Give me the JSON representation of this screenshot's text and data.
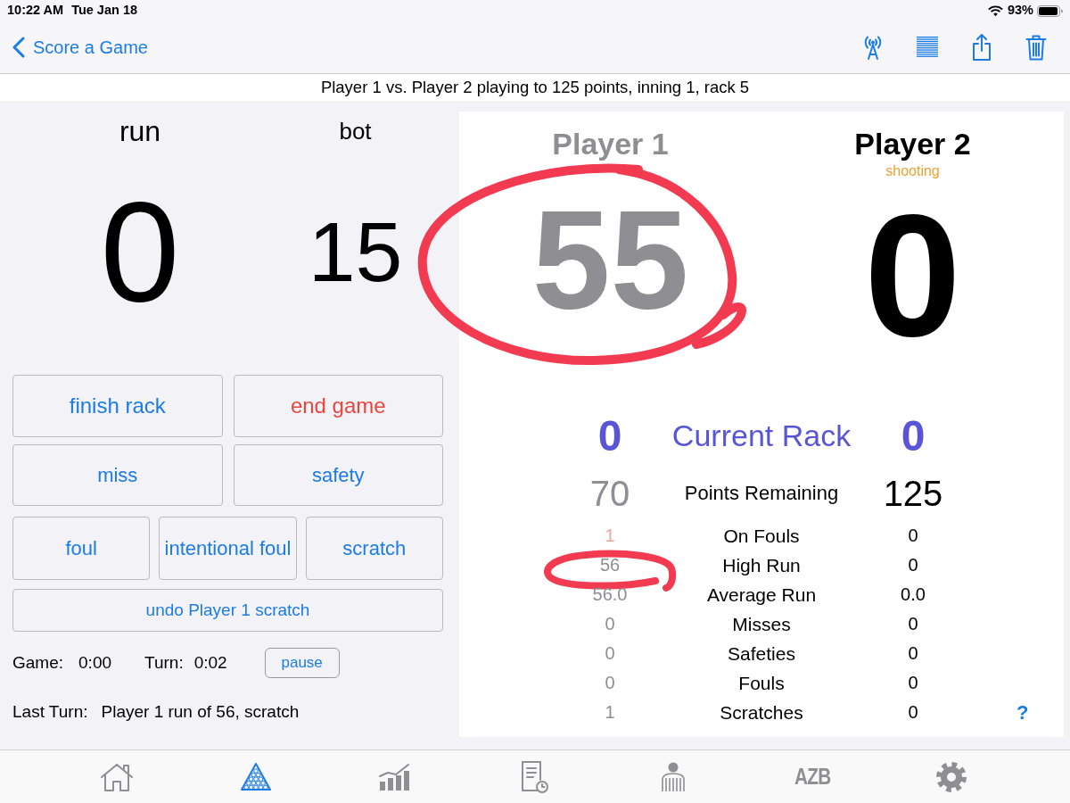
{
  "status_bar": {
    "time": "10:22 AM",
    "date": "Tue Jan 18",
    "battery": "93%"
  },
  "nav_bar": {
    "back": "Score a Game",
    "actions": [
      {
        "kind": "antenna"
      },
      {
        "kind": "list"
      },
      {
        "kind": "share"
      },
      {
        "kind": "trash"
      }
    ]
  },
  "subtitle": "Player 1 vs. Player 2 playing to 125 points, inning 1, rack 5",
  "turn": {
    "columns": [
      {
        "label": "run",
        "value": "0"
      },
      {
        "label": "bot",
        "value": "15"
      }
    ]
  },
  "button_rows": [
    {
      "buttons": [
        {
          "label": "finish rack",
          "kind": "normal"
        },
        {
          "label": "end game",
          "kind": "destructive"
        }
      ]
    },
    {
      "buttons": [
        {
          "label": "miss",
          "kind": "normal"
        },
        {
          "label": "safety",
          "kind": "normal"
        }
      ]
    },
    {
      "buttons": [
        {
          "label": "foul",
          "kind": "normal"
        },
        {
          "label": "intentional foul",
          "kind": "normal"
        },
        {
          "label": "scratch",
          "kind": "normal"
        }
      ]
    },
    {
      "buttons": [
        {
          "label": "undo Player 1 scratch",
          "kind": "normal"
        }
      ]
    }
  ],
  "timers": {
    "game_label": "Game:",
    "game": "0:00",
    "turn_label": "Turn:",
    "turn": "0:02",
    "pause": "pause"
  },
  "last_turn": {
    "label": "Last Turn:",
    "text": "Player 1 run of 56, scratch"
  },
  "scoreboard": {
    "players": [
      {
        "name": "Player 1",
        "shooting": false,
        "score": "55",
        "circled": true
      },
      {
        "name": "Player 2",
        "shooting": true,
        "status": "shooting",
        "score": "0",
        "circled": false
      }
    ],
    "current_rack": {
      "label": "Current Rack",
      "values": [
        "0",
        "0"
      ]
    },
    "points_remaining": {
      "label": "Points Remaining",
      "values": [
        "70",
        "125"
      ]
    },
    "stats": [
      {
        "label": "On Fouls",
        "cells": [
          {
            "value": "1",
            "alert": true,
            "circled": false
          },
          {
            "value": "0",
            "alert": false,
            "circled": false
          }
        ]
      },
      {
        "label": "High Run",
        "cells": [
          {
            "value": "56",
            "alert": false,
            "circled": true
          },
          {
            "value": "0",
            "alert": false,
            "circled": false
          }
        ]
      },
      {
        "label": "Average Run",
        "cells": [
          {
            "value": "56.0",
            "alert": false,
            "circled": false
          },
          {
            "value": "0.0",
            "alert": false,
            "circled": false
          }
        ]
      },
      {
        "label": "Misses",
        "cells": [
          {
            "value": "0",
            "alert": false,
            "circled": false
          },
          {
            "value": "0",
            "alert": false,
            "circled": false
          }
        ]
      },
      {
        "label": "Safeties",
        "cells": [
          {
            "value": "0",
            "alert": false,
            "circled": false
          },
          {
            "value": "0",
            "alert": false,
            "circled": false
          }
        ]
      },
      {
        "label": "Fouls",
        "cells": [
          {
            "value": "0",
            "alert": false,
            "circled": false
          },
          {
            "value": "0",
            "alert": false,
            "circled": false
          }
        ]
      },
      {
        "label": "Scratches",
        "cells": [
          {
            "value": "1",
            "alert": false,
            "circled": false
          },
          {
            "value": "0",
            "alert": false,
            "circled": false
          }
        ]
      }
    ],
    "help": "?"
  },
  "tab_bar": [
    {
      "kind": "home",
      "selected": false
    },
    {
      "kind": "rack",
      "selected": true
    },
    {
      "kind": "chart",
      "selected": false
    },
    {
      "kind": "log",
      "selected": false
    },
    {
      "kind": "referee",
      "selected": false
    },
    {
      "kind": "text",
      "text": "AZB",
      "selected": false
    },
    {
      "kind": "settings",
      "selected": false
    }
  ]
}
